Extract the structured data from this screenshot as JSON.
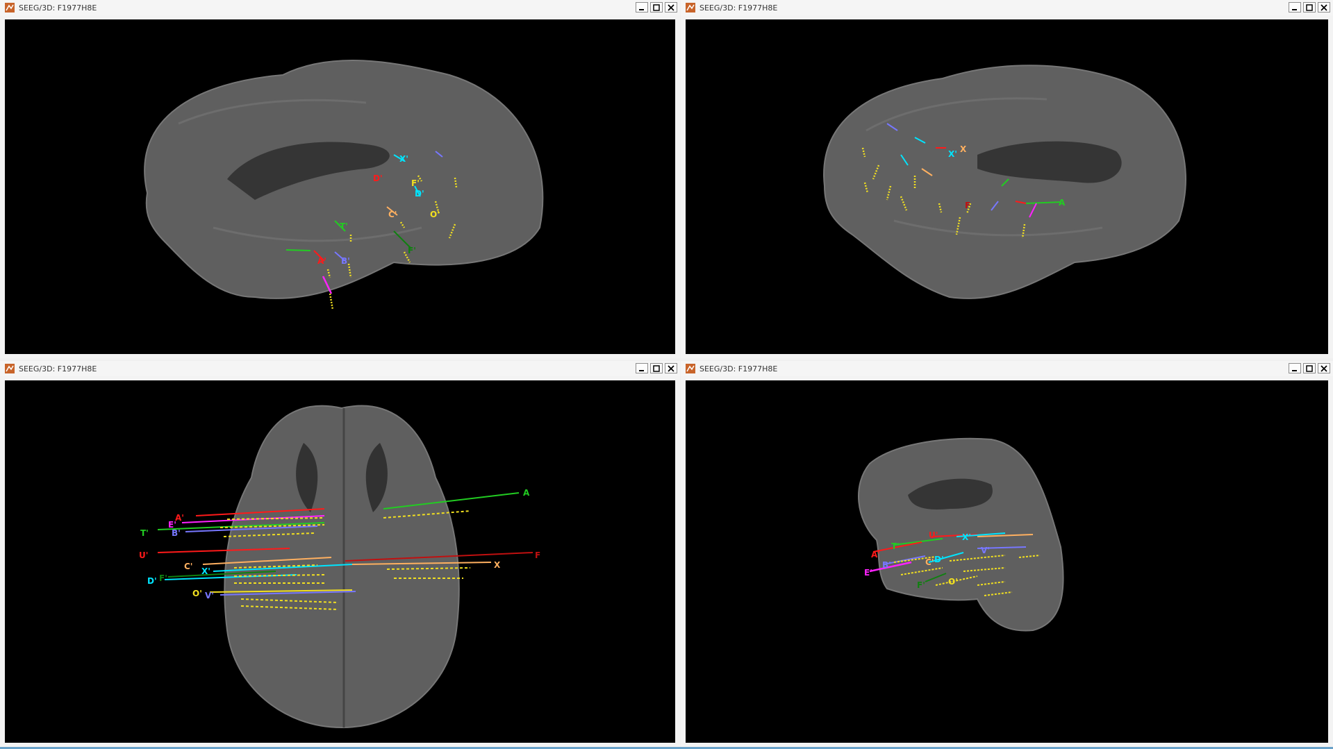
{
  "windows": [
    {
      "title": "SEEG/3D: F1977H8E"
    },
    {
      "title": "SEEG/3D: F1977H8E"
    },
    {
      "title": "SEEG/3D: F1977H8E"
    },
    {
      "title": "SEEG/3D: F1977H8E"
    }
  ],
  "view1_labels": {
    "x_prime": "X'",
    "d_red": "D'",
    "f_yellow": "F'",
    "d_prime": "D'",
    "c_prime": "C'",
    "o_prime": "O'",
    "t_prime": "T'",
    "a_prime": "A'",
    "b_prime": "B'",
    "f_green": "F'"
  },
  "view2_labels": {
    "x": "X",
    "x_prime": "X'",
    "f_dark": "F",
    "a": "A"
  },
  "view3_labels": {
    "a_top": "A",
    "a_prime": "A'",
    "e_prime": "E'",
    "t_prime": "T'",
    "b_prime": "B'",
    "u_prime": "U'",
    "c_prime": "C'",
    "x_prime": "X'",
    "f_prime": "F'",
    "d_prime": "D'",
    "o_prime": "O'",
    "v_prime": "V'",
    "x": "X",
    "f": "F"
  },
  "view4_labels": {
    "u_prime": "U'",
    "x_prime": "X'",
    "t_prime": "T'",
    "v_prime": "V'",
    "a_prime": "A'",
    "b_prime": "B'",
    "c_prime": "C'",
    "d_prime": "D'",
    "e_prime": "E'",
    "f_prime": "F'",
    "o_prime": "O'"
  },
  "colors": {
    "red": "#ff1a1a",
    "green": "#22cc22",
    "yellow": "#f2e020",
    "cyan": "#00e5ff",
    "magenta": "#ff22ff",
    "blue": "#7777ff",
    "orange": "#ffb060",
    "darkred": "#c01010",
    "darkgreen": "#108010"
  }
}
